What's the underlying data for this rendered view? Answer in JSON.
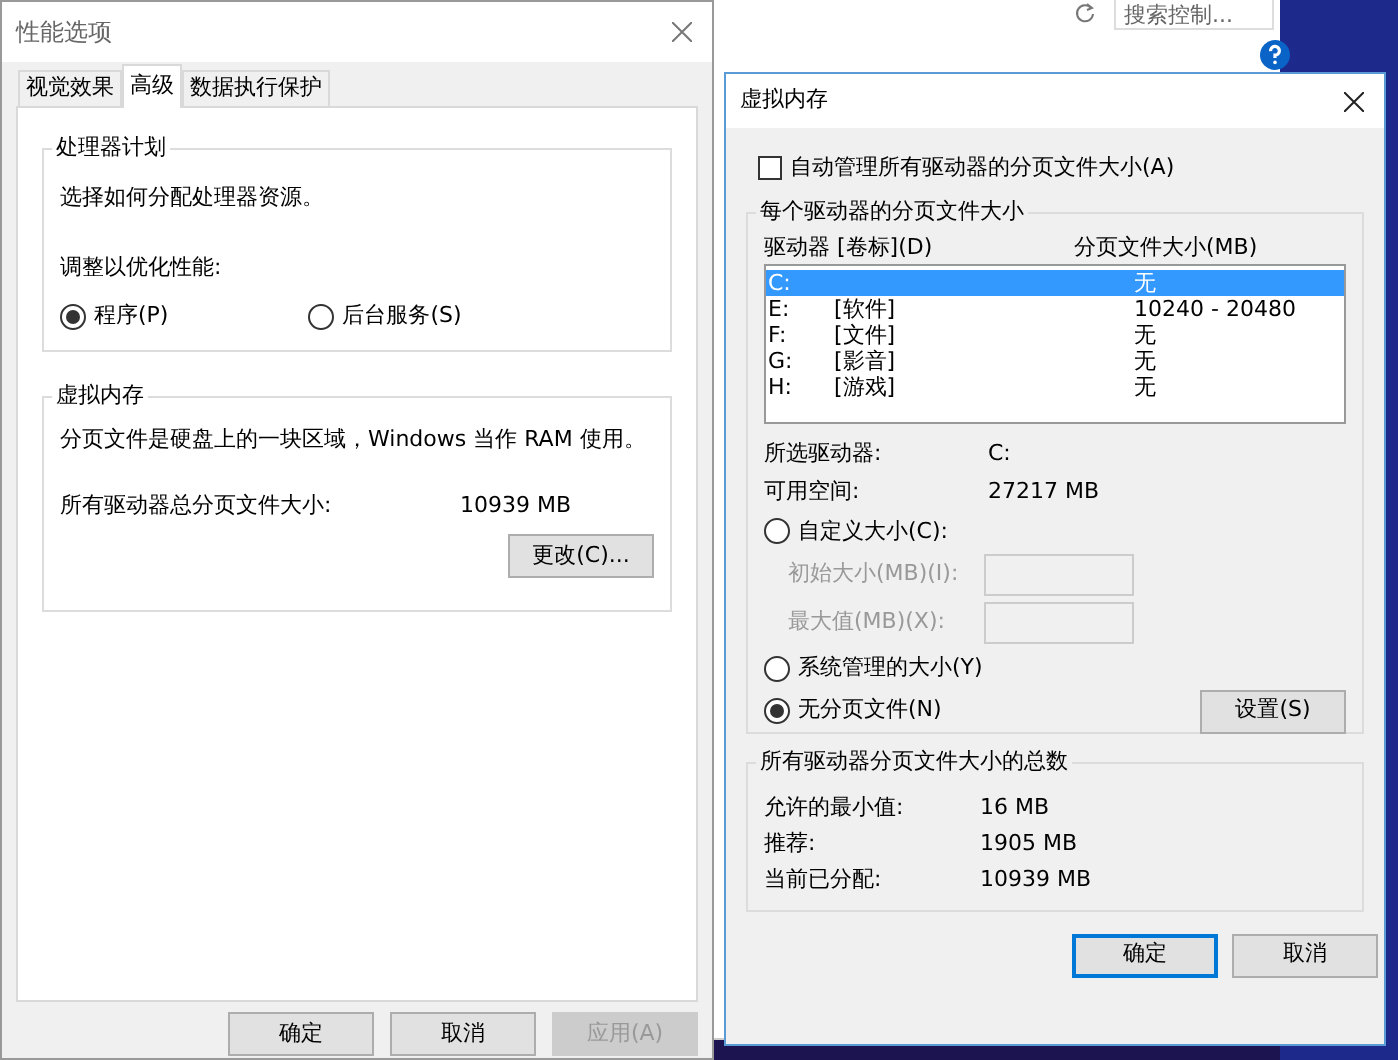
{
  "background_window": {
    "search": {
      "placeholder": "搜索控制..."
    }
  },
  "performance_options": {
    "title": "性能选项",
    "tabs": [
      {
        "label": "视觉效果",
        "selected": false
      },
      {
        "label": "高级",
        "selected": true
      },
      {
        "label": "数据执行保护",
        "selected": false
      }
    ],
    "processor_group": {
      "title": "处理器计划",
      "description": "选择如何分配处理器资源。",
      "adjust_label": "调整以优化性能:",
      "options": [
        {
          "label": "程序(P)",
          "selected": true
        },
        {
          "label": "后台服务(S)",
          "selected": false
        }
      ]
    },
    "memory_group": {
      "title": "虚拟内存",
      "description": "分页文件是硬盘上的一块区域，Windows 当作 RAM 使用。",
      "total_label": "所有驱动器总分页文件大小:",
      "total_value": "10939 MB",
      "change_button": "更改(C)..."
    },
    "buttons": [
      {
        "label": "确定",
        "disabled": false
      },
      {
        "label": "取消",
        "disabled": false
      },
      {
        "label": "应用(A)",
        "disabled": true
      }
    ]
  },
  "virtual_memory": {
    "title": "虚拟内存",
    "auto_manage": {
      "label": "自动管理所有驱动器的分页文件大小(A)",
      "checked": false
    },
    "drives_group": {
      "title": "每个驱动器的分页文件大小",
      "columns": [
        "驱动器 [卷标](D)",
        "分页文件大小(MB)"
      ],
      "rows": [
        {
          "drive": "C:",
          "label": "",
          "size": "无",
          "selected": true
        },
        {
          "drive": "E:",
          "label": "[软件]",
          "size": "10240 - 20480",
          "selected": false
        },
        {
          "drive": "F:",
          "label": "[文件]",
          "size": "无",
          "selected": false
        },
        {
          "drive": "G:",
          "label": "[影音]",
          "size": "无",
          "selected": false
        },
        {
          "drive": "H:",
          "label": "[游戏]",
          "size": "无",
          "selected": false
        }
      ],
      "selected_drive_label": "所选驱动器:",
      "selected_drive_value": "C:",
      "free_space_label": "可用空间:",
      "free_space_value": "27217 MB",
      "size_options": [
        {
          "label": "自定义大小(C):",
          "selected": false
        },
        {
          "label": "系统管理的大小(Y)",
          "selected": false
        },
        {
          "label": "无分页文件(N)",
          "selected": true
        }
      ],
      "fields": [
        {
          "label": "初始大小(MB)(I):",
          "disabled": true
        },
        {
          "label": "最大值(MB)(X):",
          "disabled": true
        }
      ],
      "set_button": "设置(S)"
    },
    "totals_group": {
      "title": "所有驱动器分页文件大小的总数",
      "rows": [
        {
          "label": "允许的最小值:",
          "value": "16 MB"
        },
        {
          "label": "推荐:",
          "value": "1905 MB"
        },
        {
          "label": "当前已分配:",
          "value": "10939 MB"
        }
      ]
    },
    "buttons": [
      {
        "label": "确定",
        "focused": true
      },
      {
        "label": "取消",
        "focused": false
      }
    ]
  }
}
